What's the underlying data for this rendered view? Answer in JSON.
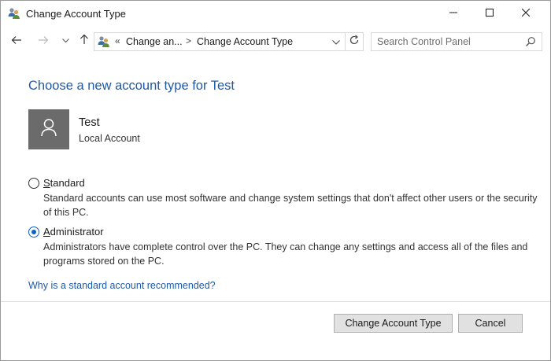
{
  "window": {
    "title": "Change Account Type",
    "icon": "users-control-panel-icon",
    "controls": {
      "minimize": "minimize-icon",
      "maximize": "maximize-icon",
      "close": "close-icon"
    }
  },
  "nav": {
    "address": {
      "overflow": "«",
      "crumbs": [
        "Change an...",
        "Change Account Type"
      ],
      "separator": ">"
    },
    "search": {
      "placeholder": "Search Control Panel"
    }
  },
  "content": {
    "heading": "Choose a new account type for Test",
    "user": {
      "name": "Test",
      "type": "Local Account"
    },
    "options": [
      {
        "mnemonic": "S",
        "rest": "tandard",
        "description": "Standard accounts can use most software and change system settings that don't affect other users or the security of this PC.",
        "selected": false
      },
      {
        "mnemonic": "A",
        "rest": "dministrator",
        "description": "Administrators have complete control over the PC. They can change any settings and access all of the files and programs stored on the PC.",
        "selected": true
      }
    ],
    "help_link": "Why is a standard account recommended?"
  },
  "buttons": {
    "change": "Change Account Type",
    "cancel": "Cancel"
  },
  "colors": {
    "accent": "#1e5aa8",
    "radio_selected": "#0a64c8",
    "avatar_bg": "#6b6b6b"
  }
}
